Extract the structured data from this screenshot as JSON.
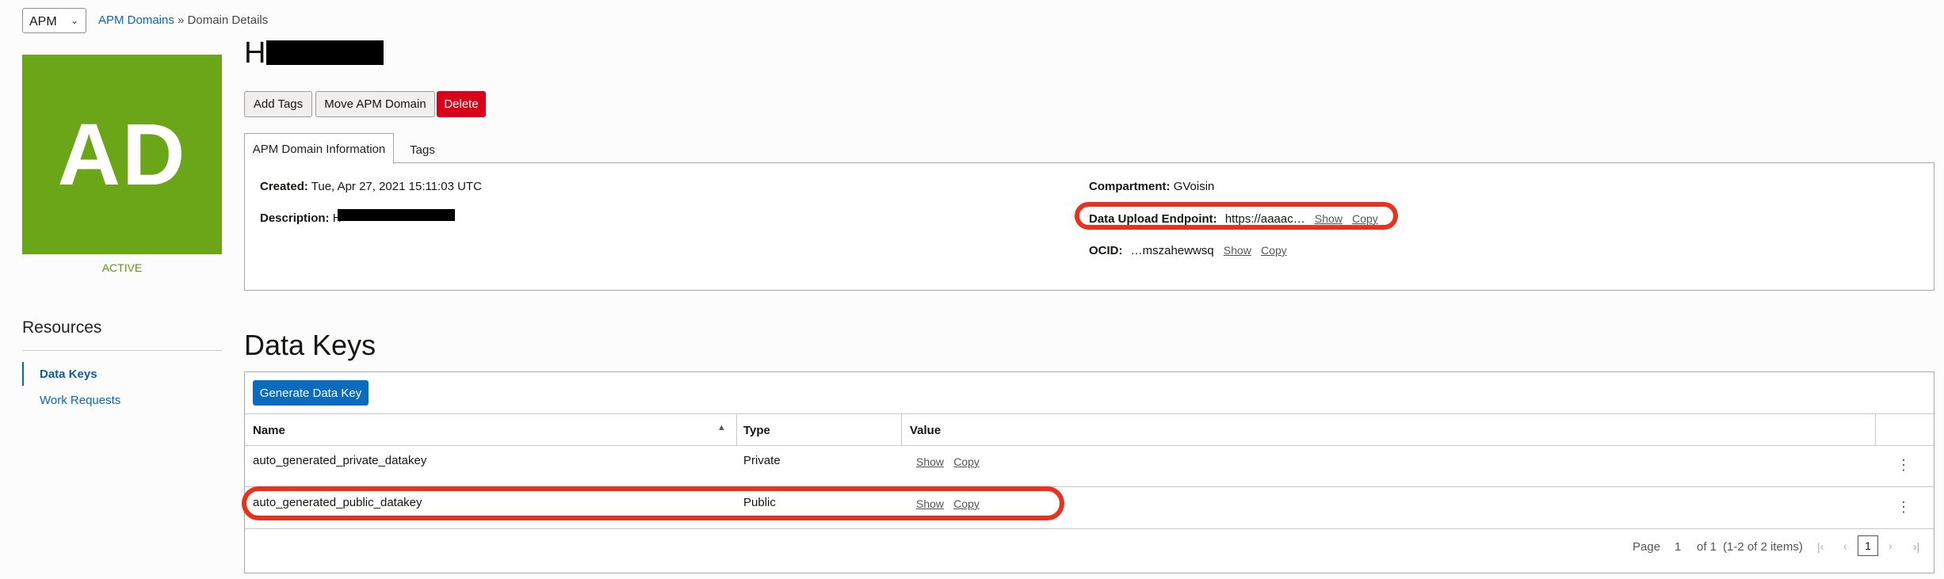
{
  "header": {
    "scope": "APM",
    "breadcrumb_link": "APM Domains",
    "breadcrumb_sep": "»",
    "breadcrumb_current": "Domain Details"
  },
  "domain": {
    "title_prefix": "H",
    "avatar_initials": "AD",
    "status": "ACTIVE",
    "avatar_color": "#6aa617"
  },
  "actions": {
    "add_tags": "Add Tags",
    "move": "Move APM Domain",
    "delete": "Delete"
  },
  "tabs": [
    {
      "label": "APM Domain Information"
    },
    {
      "label": "Tags"
    }
  ],
  "info": {
    "created_label": "Created:",
    "created_value": "Tue, Apr 27, 2021 15:11:03 UTC",
    "description_label": "Description:",
    "description_value": "H",
    "compartment_label": "Compartment:",
    "compartment_value": "GVoisin",
    "endpoint_label": "Data Upload Endpoint:",
    "endpoint_value": "https://aaaac…",
    "ocid_label": "OCID:",
    "ocid_value": "…mszahewwsq",
    "show": "Show",
    "copy": "Copy"
  },
  "resources": {
    "title": "Resources",
    "items": [
      {
        "label": "Data Keys"
      },
      {
        "label": "Work Requests"
      }
    ]
  },
  "data_keys": {
    "title": "Data Keys",
    "generate": "Generate Data Key",
    "columns": [
      "Name",
      "Type",
      "Value"
    ],
    "rows": [
      {
        "name": "auto_generated_private_datakey",
        "type": "Private",
        "show": "Show",
        "copy": "Copy"
      },
      {
        "name": "auto_generated_public_datakey",
        "type": "Public",
        "show": "Show",
        "copy": "Copy"
      }
    ],
    "pagination": {
      "page_label": "Page",
      "page": "1",
      "of": "of 1",
      "items": "(1-2 of 2 items)",
      "current": "1"
    }
  },
  "colors": {
    "link": "#0b67b5",
    "danger": "#d9001b",
    "primary": "#0a6bbf",
    "annotation": "#e8321d"
  }
}
